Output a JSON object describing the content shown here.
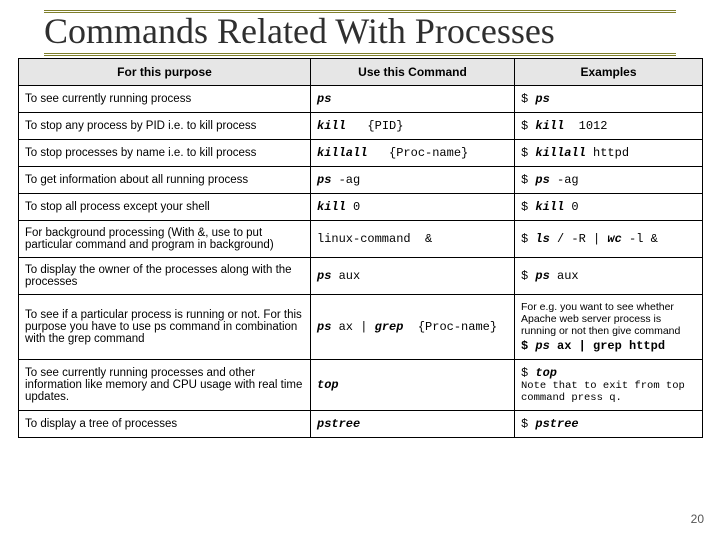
{
  "slide": {
    "title": "Commands Related With Processes",
    "page_number": "20"
  },
  "table": {
    "headers": [
      "For this purpose",
      "Use this Command",
      "Examples"
    ],
    "rows": [
      {
        "purpose": "To see currently running process",
        "command_html": "<b><i>ps</i></b>",
        "example_html": "$ <b><i>ps</i></b>"
      },
      {
        "purpose": "To stop any process by PID i.e. to kill process",
        "command_html": "<b><i>kill</i></b>&nbsp;&nbsp;&nbsp;{PID}",
        "example_html": "$ <b><i>kill</i></b>&nbsp;&nbsp;1012"
      },
      {
        "purpose": "To stop processes by name i.e. to kill process",
        "command_html": "<b><i>killall</i></b>&nbsp;&nbsp;&nbsp;{Proc-name}",
        "example_html": "$ <b><i>killall</i></b> httpd"
      },
      {
        "purpose": "To get information about all running process",
        "command_html": "<b><i>ps</i></b> -ag",
        "example_html": "$ <b><i>ps</i></b> -ag"
      },
      {
        "purpose": "To stop all process except your shell",
        "command_html": "<b><i>kill</i></b> 0",
        "example_html": "$ <b><i>kill</i></b> 0"
      },
      {
        "purpose": "For background processing (With &, use to put particular command and program in background)",
        "command_html": "linux-command&nbsp;&nbsp;&amp;",
        "example_html": "$ <b><i>ls</i></b> / -R | <b><i>wc</i></b> -l &amp;"
      },
      {
        "purpose": "To display the owner of the processes along with the processes",
        "command_html": "<b><i>ps</i></b> aux",
        "example_html": "$ <b><i>ps</i></b> aux"
      },
      {
        "purpose": "To see if a particular process is running or not. For this purpose you have to use ps command in combination with the grep command",
        "command_html": "<b><i>ps</i></b> ax | <b><i>grep</i></b>&nbsp;&nbsp;{Proc-name}",
        "example_note": "For e.g. you want to see whether Apache web server process is running or not then give command",
        "example_html": "<b>$</b> <b><i>ps</i></b> <b>ax | grep httpd</b>"
      },
      {
        "purpose": "To see currently running processes and other information like memory and CPU usage with real time updates.",
        "command_html": "<b><i>top</i></b>",
        "example_top": "$ <b><i>top</i></b>",
        "example_note_mono": "Note that to exit from top command press q."
      },
      {
        "purpose": "To display a tree of processes",
        "command_html": "<b><i>pstree</i></b>",
        "example_html": "$ <b><i>pstree</i></b>"
      }
    ]
  }
}
